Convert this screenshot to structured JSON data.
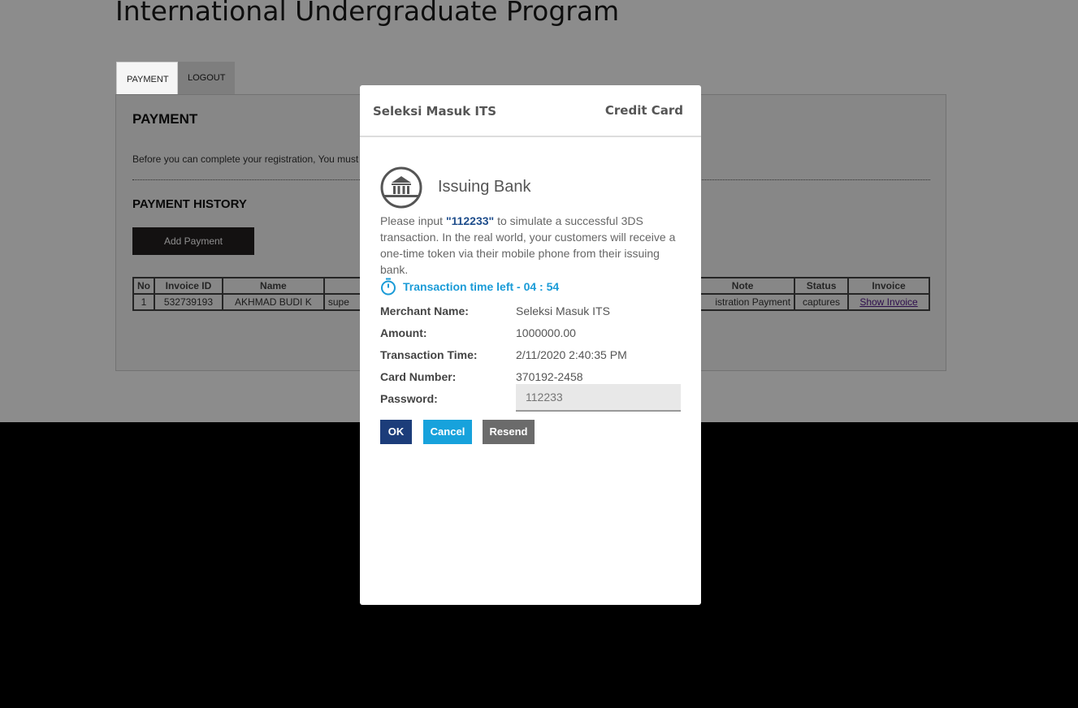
{
  "background": {
    "page_title": "International Undergraduate Program",
    "tabs": [
      {
        "label": "PAYMENT"
      },
      {
        "label": "LOGOUT"
      }
    ],
    "payment_heading": "PAYMENT",
    "payment_desc": "Before you can complete your registration, You must",
    "history_heading": "PAYMENT HISTORY",
    "add_payment_label": "Add Payment",
    "table": {
      "headers": [
        "No",
        "Invoice ID",
        "Name",
        "",
        "Note",
        "Status",
        "Invoice"
      ],
      "row": [
        "1",
        "532739193",
        "AKHMAD BUDI K",
        "supe",
        "istration Payment",
        "captures",
        "Show Invoice"
      ]
    }
  },
  "modal": {
    "merchant_title": "Seleksi Masuk ITS",
    "payment_type": "Credit Card",
    "bank_title": "Issuing Bank",
    "instruction_prefix": "Please input ",
    "instruction_code": "\"112233\"",
    "instruction_suffix": " to simulate a successful 3DS transaction. In the real world, your customers will receive a one-time token via their mobile phone from their issuing bank.",
    "timer_label": "Transaction time left -  04 : 54",
    "fields": [
      {
        "label": "Merchant Name:",
        "value": "Seleksi Masuk ITS"
      },
      {
        "label": "Amount:",
        "value": "1000000.00"
      },
      {
        "label": "Transaction Time:",
        "value": "2/11/2020 2:40:35 PM"
      },
      {
        "label": "Card Number:",
        "value": "370192-2458"
      },
      {
        "label": "Password:",
        "value": ""
      }
    ],
    "password_placeholder": "112233",
    "buttons": {
      "ok": "OK",
      "cancel": "Cancel",
      "resend": "Resend"
    },
    "colors": {
      "ok": "#1c3d7a",
      "cancel": "#17a2dc",
      "resend": "#6b6b6b",
      "timer": "#1a9bd7"
    },
    "icons": {
      "bank": "bank-icon",
      "timer": "stopwatch-icon"
    }
  }
}
